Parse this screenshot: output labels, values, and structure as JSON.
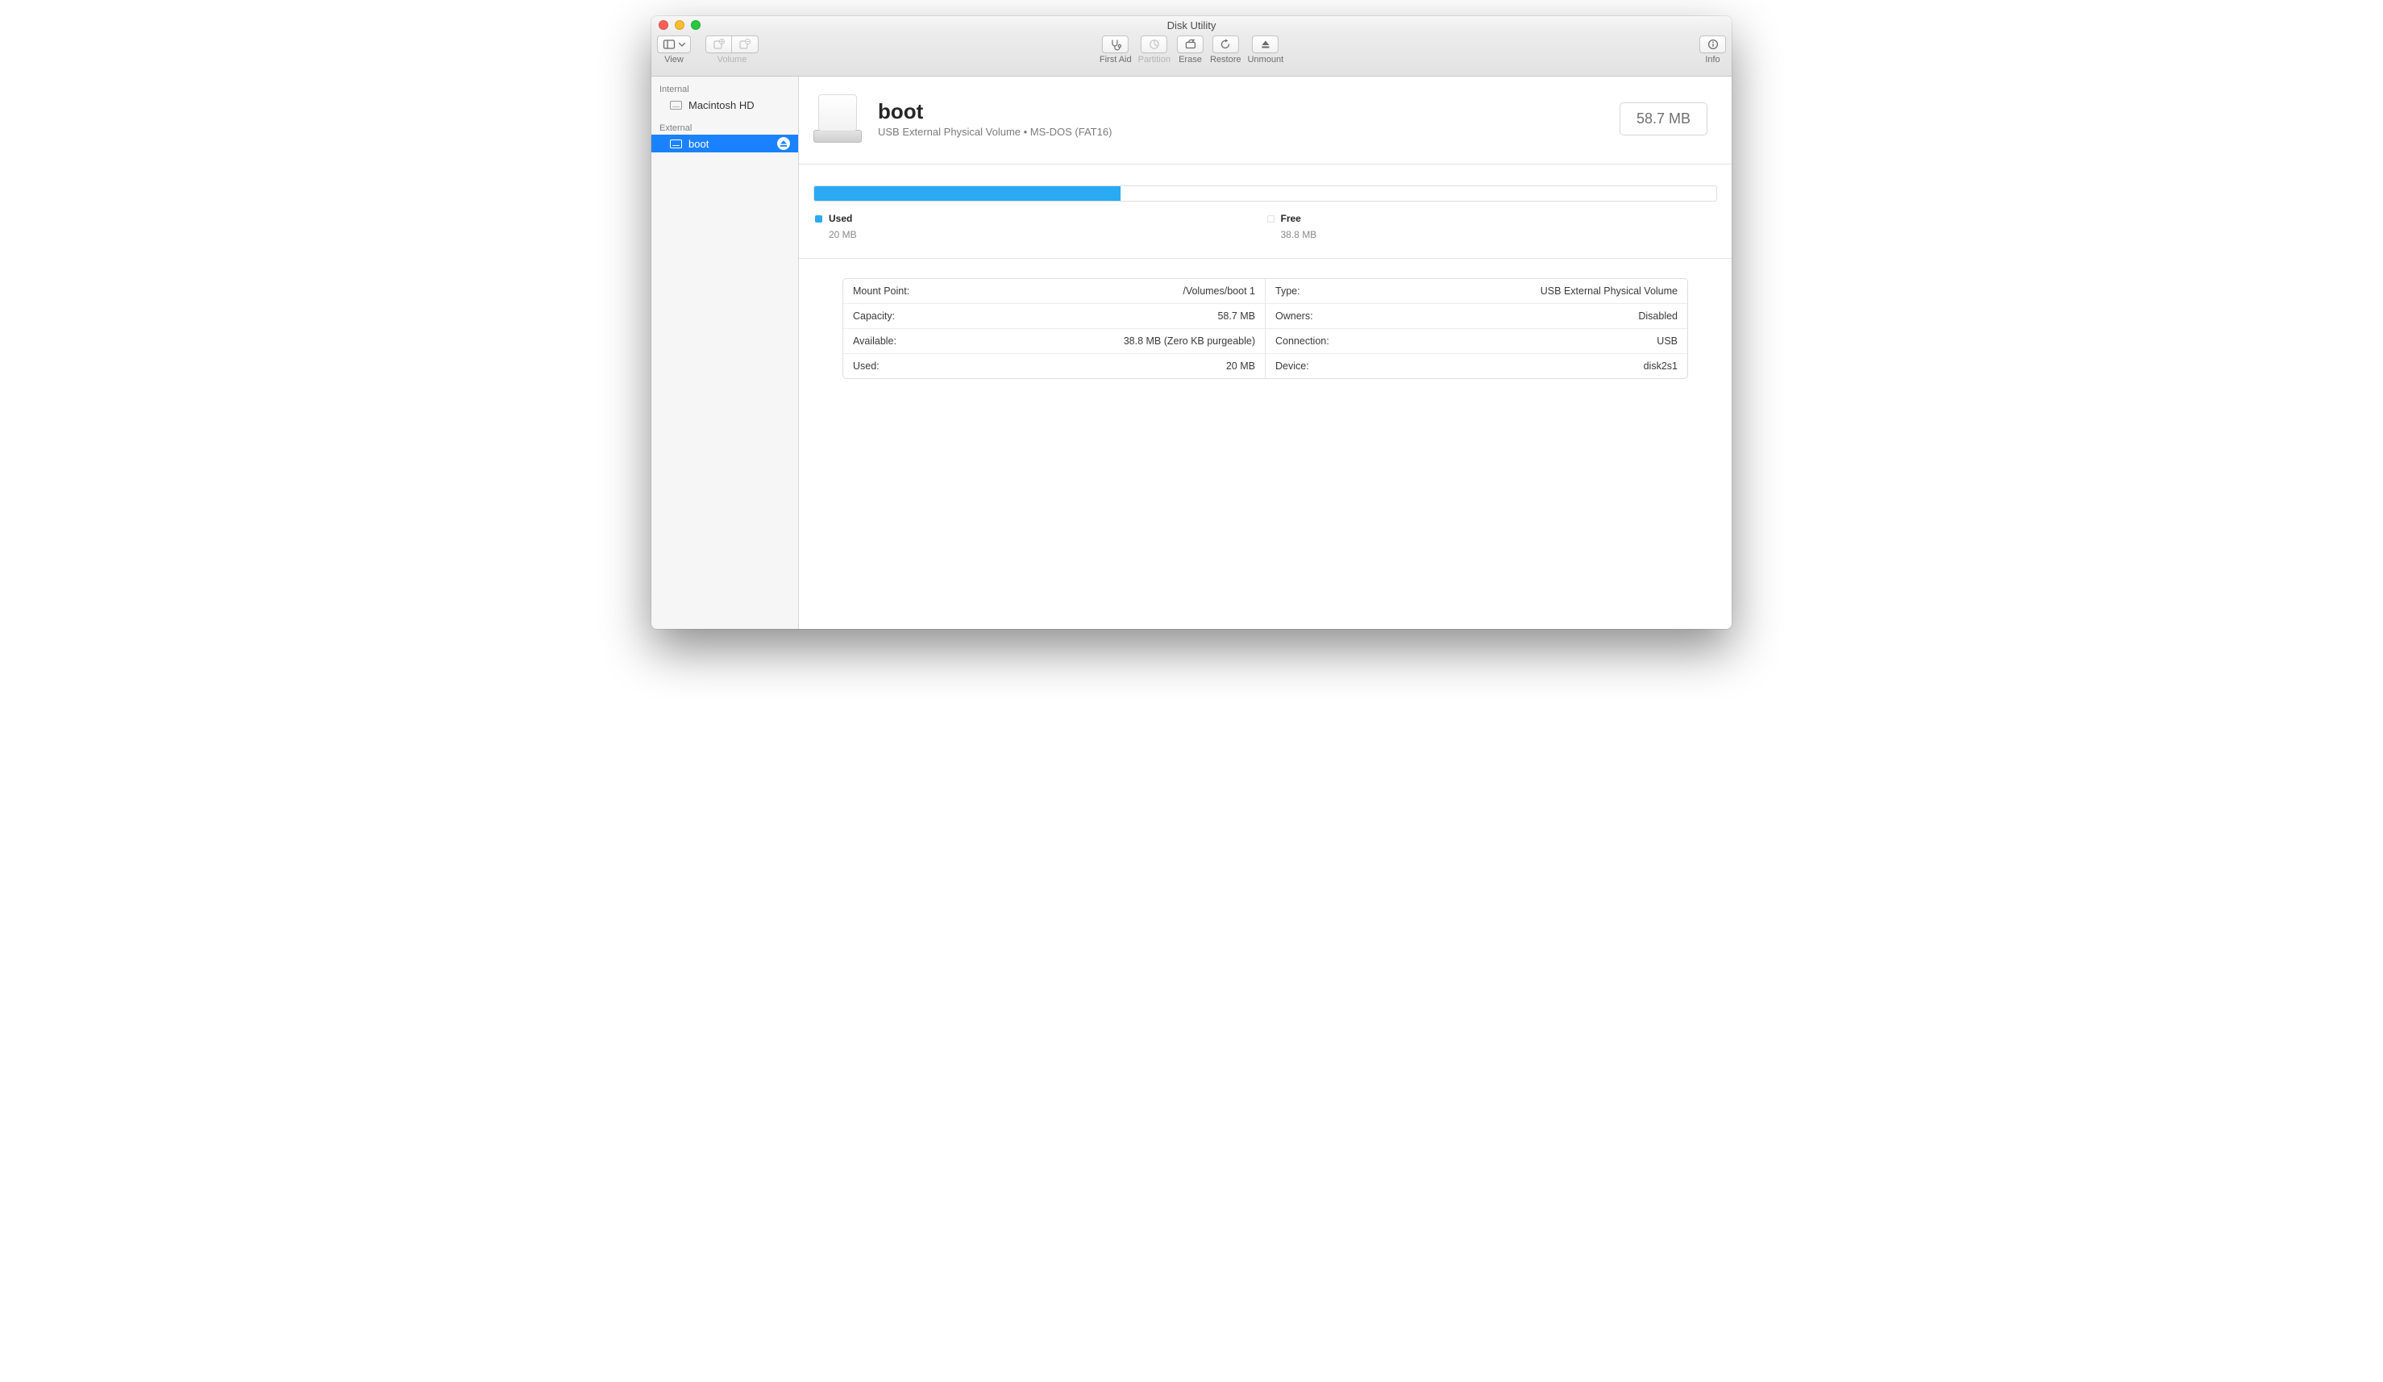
{
  "window": {
    "title": "Disk Utility"
  },
  "toolbar": {
    "view_label": "View",
    "volume_label": "Volume",
    "first_aid": "First Aid",
    "partition": "Partition",
    "erase": "Erase",
    "restore": "Restore",
    "unmount": "Unmount",
    "info": "Info"
  },
  "sidebar": {
    "internal_header": "Internal",
    "external_header": "External",
    "internal": [
      {
        "name": "Macintosh HD"
      }
    ],
    "external": [
      {
        "name": "boot"
      }
    ]
  },
  "volume": {
    "name": "boot",
    "subtitle": "USB External Physical Volume • MS-DOS (FAT16)",
    "size_badge": "58.7 MB"
  },
  "usage": {
    "used_label": "Used",
    "used_value": "20 MB",
    "free_label": "Free",
    "free_value": "38.8 MB",
    "fill_percent": 34,
    "used_color": "#29aaf3",
    "free_color": "#ffffff"
  },
  "details": {
    "left": [
      {
        "k": "Mount Point:",
        "v": "/Volumes/boot 1"
      },
      {
        "k": "Capacity:",
        "v": "58.7 MB"
      },
      {
        "k": "Available:",
        "v": "38.8 MB (Zero KB purgeable)"
      },
      {
        "k": "Used:",
        "v": "20 MB"
      }
    ],
    "right": [
      {
        "k": "Type:",
        "v": "USB External Physical Volume"
      },
      {
        "k": "Owners:",
        "v": "Disabled"
      },
      {
        "k": "Connection:",
        "v": "USB"
      },
      {
        "k": "Device:",
        "v": "disk2s1"
      }
    ]
  }
}
